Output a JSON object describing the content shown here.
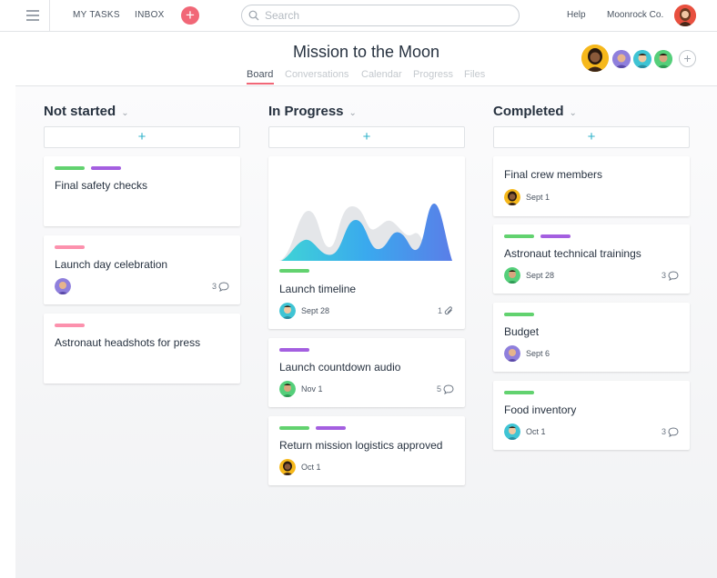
{
  "topbar": {
    "my_tasks": "MY TASKS",
    "inbox": "INBOX",
    "add_symbol": "+",
    "search_placeholder": "Search",
    "help": "Help",
    "workspace": "Moonrock Co."
  },
  "project": {
    "title": "Mission to the Moon",
    "tabs": [
      "Board",
      "Conversations",
      "Calendar",
      "Progress",
      "Files"
    ],
    "active_tab": "Board",
    "add_member_symbol": "+"
  },
  "colors": {
    "accent": "#f16777",
    "teal": "#2db2c9",
    "tag_green": "#62d26f",
    "tag_purple": "#a45fe0",
    "tag_pink": "#fc91ad"
  },
  "columns": [
    {
      "title": "Not started",
      "add_symbol": "+",
      "cards": [
        {
          "title": "Final safety checks",
          "tags": [
            "green",
            "purple"
          ]
        },
        {
          "title": "Launch day celebration",
          "tags": [
            "pink"
          ],
          "date": "",
          "count": "3",
          "count_icon": "comment-icon"
        },
        {
          "title": "Astronaut headshots for press",
          "tags": [
            "pink"
          ]
        }
      ]
    },
    {
      "title": "In Progress",
      "add_symbol": "+",
      "cards": [
        {
          "title": "Launch timeline",
          "tags": [
            "green"
          ],
          "date": "Sept 28",
          "count": "1",
          "count_icon": "paperclip-icon",
          "has_image": true
        },
        {
          "title": "Launch countdown audio",
          "tags": [
            "purple"
          ],
          "date": "Nov 1",
          "count": "5",
          "count_icon": "comment-icon"
        },
        {
          "title": "Return mission logistics approved",
          "tags": [
            "green",
            "purple"
          ],
          "date": "Oct 1"
        }
      ]
    },
    {
      "title": "Completed",
      "add_symbol": "+",
      "cards": [
        {
          "title": "Final crew members",
          "tags": [],
          "date": "Sept 1"
        },
        {
          "title": "Astronaut technical trainings",
          "tags": [
            "green",
            "purple"
          ],
          "date": "Sept 28",
          "count": "3",
          "count_icon": "comment-icon"
        },
        {
          "title": "Budget",
          "tags": [
            "green"
          ],
          "date": "Sept 6"
        },
        {
          "title": "Food inventory",
          "tags": [
            "green"
          ],
          "date": "Oct 1",
          "count": "3",
          "count_icon": "comment-icon"
        }
      ]
    }
  ]
}
